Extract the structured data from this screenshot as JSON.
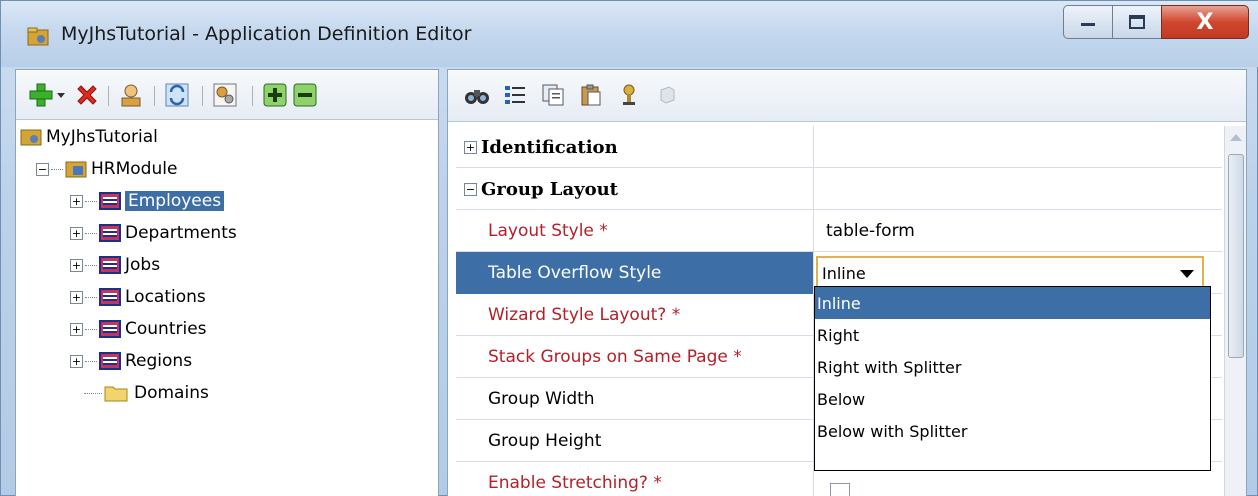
{
  "window": {
    "title": "MyJhsTutorial - Application Definition Editor",
    "controls": {
      "minimize": "—",
      "maximize": "☐",
      "close": "X"
    }
  },
  "left_toolbar": {
    "icons": [
      "add-icon",
      "dropdown-arrow-icon",
      "delete-icon",
      "user-icon",
      "refresh-icon",
      "generate-icon",
      "expand-all-icon",
      "collapse-all-icon"
    ]
  },
  "tree": {
    "root": "MyJhsTutorial",
    "module": "HRModule",
    "items": [
      {
        "label": "Employees",
        "selected": true
      },
      {
        "label": "Departments"
      },
      {
        "label": "Jobs"
      },
      {
        "label": "Locations"
      },
      {
        "label": "Countries"
      },
      {
        "label": "Regions"
      }
    ],
    "domains": "Domains"
  },
  "right_toolbar": {
    "icons": [
      "binoculars-icon",
      "list-icon",
      "copy-icon",
      "paste-icon",
      "pin-icon",
      "plugin-icon"
    ]
  },
  "properties": {
    "groups": [
      {
        "label": "Identification",
        "expanded": false
      },
      {
        "label": "Group Layout",
        "expanded": true
      }
    ],
    "rows": [
      {
        "name": "Layout Style *",
        "value": "table-form",
        "required": true
      },
      {
        "name": "Table Overflow Style",
        "value": "Inline",
        "selected": true
      },
      {
        "name": "Wizard Style Layout? *",
        "value": "",
        "required": true
      },
      {
        "name": "Stack Groups on Same Page *",
        "value": "",
        "required": true
      },
      {
        "name": "Group Width",
        "value": ""
      },
      {
        "name": "Group Height",
        "value": ""
      },
      {
        "name": "Enable Stretching? *",
        "value": "",
        "required": true
      }
    ]
  },
  "dropdown": {
    "options": [
      "Inline",
      "Right",
      "Right with Splitter",
      "Below",
      "Below with Splitter"
    ],
    "selected": "Inline"
  },
  "colors": {
    "selection": "#3d6ea6",
    "required_text": "#b3202a",
    "combo_border": "#e0b24a"
  }
}
